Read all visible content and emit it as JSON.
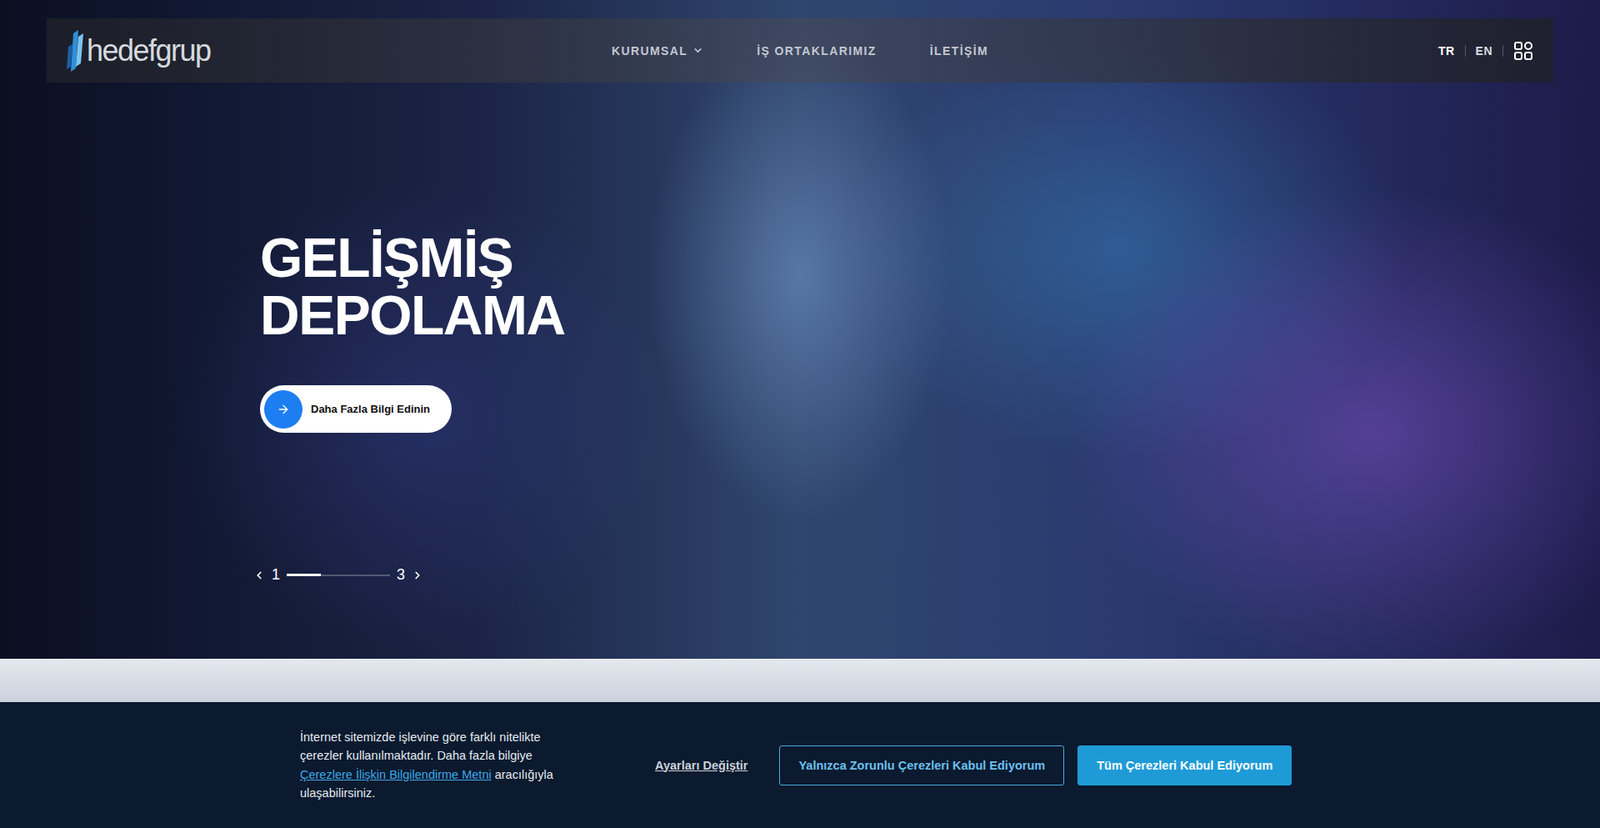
{
  "logo": {
    "text": "hedefgrup"
  },
  "nav": {
    "items": [
      {
        "label": "KURUMSAL",
        "has_dropdown": true
      },
      {
        "label": "İŞ ORTAKLARIMIZ",
        "has_dropdown": false
      },
      {
        "label": "İLETİŞİM",
        "has_dropdown": false
      }
    ],
    "languages": [
      {
        "label": "TR",
        "selected": true
      },
      {
        "label": "EN",
        "selected": false
      }
    ]
  },
  "hero": {
    "title_lines": [
      "GELİŞMİŞ",
      "DEPOLAMA"
    ],
    "button": {
      "label": "Daha Fazla Bilgi Edinin"
    },
    "slider": {
      "current": "1",
      "total": "3",
      "level": 0.33
    }
  },
  "cookie_banner": {
    "text_before": "İnternet sitemizde işlevine göre farklı nitelikte çerezler kullanılmaktadır. Daha fazla bilgiye ",
    "link": "Çerezlere İlişkin Bilgilendirme Metni",
    "text_after": " aracılığıyla ulaşabilirsiniz.",
    "settings": "Ayarları Değiştir",
    "buttons": [
      {
        "label": "Yalnızca Zorunlu Çerezleri Kabul Ediyorum",
        "kind": "outline"
      },
      {
        "label": "Tüm Çerezleri Kabul Ediyorum",
        "kind": "filled"
      }
    ]
  }
}
